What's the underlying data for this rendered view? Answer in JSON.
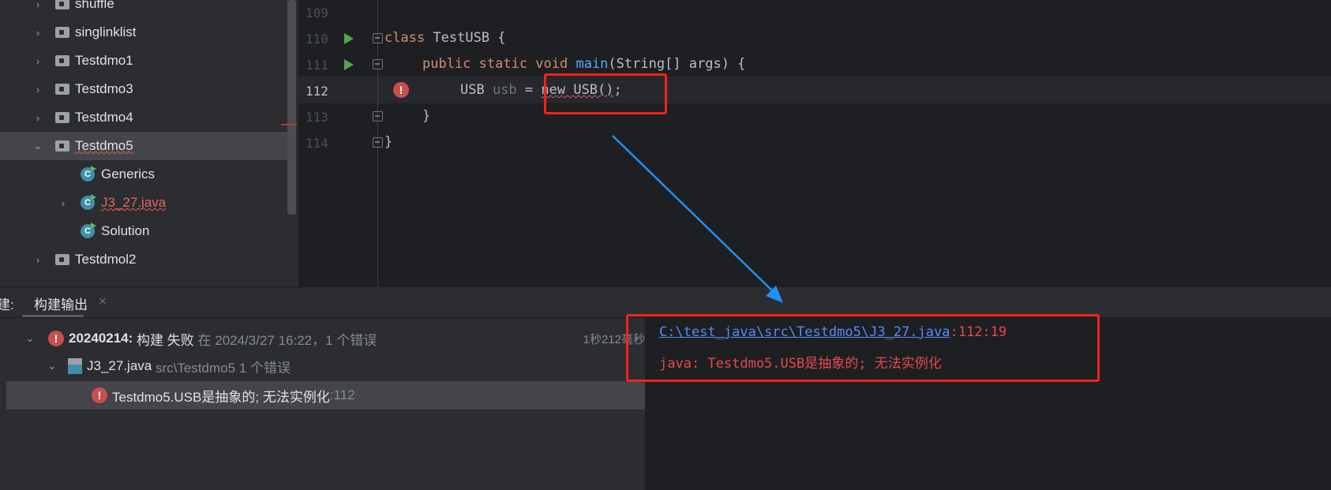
{
  "project_tree": [
    {
      "label": "shuffle",
      "type": "folder",
      "expanded": false
    },
    {
      "label": "singlinklist",
      "type": "folder",
      "expanded": false
    },
    {
      "label": "Testdmo1",
      "type": "folder",
      "expanded": false
    },
    {
      "label": "Testdmo3",
      "type": "folder",
      "expanded": false
    },
    {
      "label": "Testdmo4",
      "type": "folder",
      "expanded": false
    },
    {
      "label": "Testdmo5",
      "type": "folder",
      "expanded": true,
      "selected": true,
      "error": true
    },
    {
      "label": "Generics",
      "type": "class"
    },
    {
      "label": "J3_27.java",
      "type": "class",
      "error": true
    },
    {
      "label": "Solution",
      "type": "class"
    },
    {
      "label": "Testdmol2",
      "type": "folder",
      "expanded": false
    }
  ],
  "editor": {
    "line_numbers": [
      "109",
      "110",
      "111",
      "112",
      "113",
      "114"
    ],
    "lines": {
      "l110_kw": "class",
      "l110_rest": " TestUSB {",
      "l111_kw": "public static void ",
      "l111_fn": "main",
      "l111_rest": "(String[] args) {",
      "l112_a": "USB ",
      "l112_var": "usb",
      "l112_eq": " = ",
      "l112_err": "new USB()",
      "l112_end": ";",
      "l113": "}",
      "l114": "}"
    }
  },
  "build_panel": {
    "tab_prefix": "建:",
    "tab_label": "构建输出",
    "close_icon": "×",
    "root": {
      "name": "20240214:",
      "status": "构建 失败",
      "time": "在 2024/3/27 16:22，1 个错误",
      "duration": "1秒212毫秒"
    },
    "file": {
      "name": "J3_27.java",
      "path": "src\\Testdmo5 1 个错误"
    },
    "error": {
      "message": "Testdmo5.USB是抽象的; 无法实例化",
      "line": ":112"
    }
  },
  "output": {
    "link": "C:\\test_java\\src\\Testdmo5\\J3_27.java",
    "position": ":112:19",
    "message": "java: Testdmo5.USB是抽象的; 无法实例化"
  },
  "colors": {
    "annotation": "#f2231b",
    "arrow": "#1e90ff",
    "error": "#e5484d",
    "link": "#548af7"
  }
}
